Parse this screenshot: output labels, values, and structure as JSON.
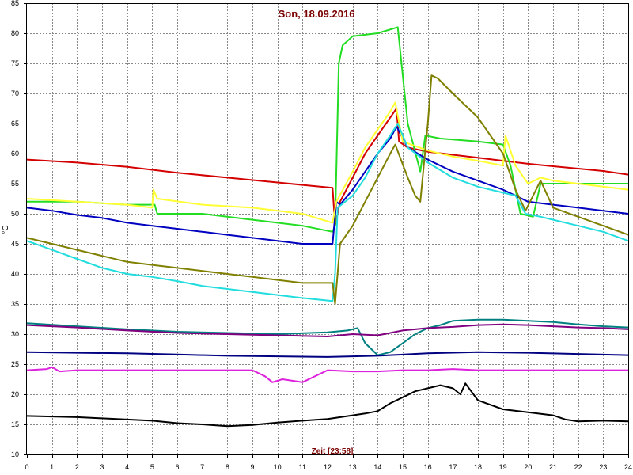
{
  "chart_data": {
    "type": "line",
    "title": "Son, 18.09.2016",
    "xlabel": "Zeit [23:58]",
    "ylabel": "°C",
    "xlim": [
      0,
      24
    ],
    "ylim": [
      10,
      85
    ],
    "x_ticks": [
      "0",
      "1",
      "2",
      "3",
      "4",
      "5",
      "6",
      "7",
      "8",
      "9",
      "10",
      "11",
      "12",
      "13",
      "14",
      "15",
      "16",
      "17",
      "18",
      "19",
      "20",
      "21",
      "22",
      "23",
      "24"
    ],
    "y_ticks": [
      "10",
      "15",
      "20",
      "25",
      "30",
      "35",
      "40",
      "45",
      "50",
      "55",
      "60",
      "65",
      "70",
      "75",
      "80",
      "85"
    ],
    "grid": true,
    "series": [
      {
        "color": "#d40000",
        "points": [
          [
            0,
            59
          ],
          [
            2,
            58.5
          ],
          [
            4,
            57.8
          ],
          [
            6,
            56.8
          ],
          [
            8,
            56
          ],
          [
            10,
            55.2
          ],
          [
            12.2,
            54.3
          ],
          [
            12.3,
            48
          ],
          [
            12.5,
            52
          ],
          [
            13,
            56
          ],
          [
            13.5,
            60
          ],
          [
            14,
            63
          ],
          [
            14.5,
            66
          ],
          [
            14.75,
            67.5
          ],
          [
            14.85,
            62
          ],
          [
            15.2,
            61
          ],
          [
            16,
            60.3
          ],
          [
            17,
            59.8
          ],
          [
            18,
            59.3
          ],
          [
            19,
            58.8
          ],
          [
            20,
            58.3
          ],
          [
            21,
            57.9
          ],
          [
            22,
            57.5
          ],
          [
            23,
            57.1
          ],
          [
            24,
            56.5
          ]
        ]
      },
      {
        "color": "#22dd22",
        "points": [
          [
            0,
            52
          ],
          [
            2,
            52
          ],
          [
            4,
            51.5
          ],
          [
            5.1,
            51.5
          ],
          [
            5.2,
            50
          ],
          [
            7,
            50
          ],
          [
            9,
            49
          ],
          [
            11,
            48
          ],
          [
            12.2,
            47
          ],
          [
            12.3,
            48
          ],
          [
            12.45,
            75
          ],
          [
            12.6,
            78
          ],
          [
            13,
            79.5
          ],
          [
            14,
            80
          ],
          [
            14.8,
            81
          ],
          [
            15.2,
            65
          ],
          [
            15.7,
            57
          ],
          [
            15.9,
            63
          ],
          [
            16.5,
            62.5
          ],
          [
            18,
            62
          ],
          [
            19,
            61.5
          ],
          [
            19.3,
            58
          ],
          [
            19.7,
            50
          ],
          [
            20.2,
            49.5
          ],
          [
            20.5,
            55
          ],
          [
            21,
            55
          ],
          [
            22,
            55
          ],
          [
            23,
            55
          ],
          [
            24,
            55
          ]
        ]
      },
      {
        "color": "#0000c0",
        "points": [
          [
            0,
            51
          ],
          [
            1,
            50.5
          ],
          [
            2,
            49.8
          ],
          [
            3,
            49.3
          ],
          [
            4,
            48.5
          ],
          [
            5,
            48
          ],
          [
            6,
            47.5
          ],
          [
            7,
            47
          ],
          [
            8,
            46.5
          ],
          [
            9,
            46
          ],
          [
            10,
            45.5
          ],
          [
            11,
            45
          ],
          [
            12.2,
            45
          ],
          [
            12.35,
            52
          ],
          [
            12.5,
            51.5
          ],
          [
            13,
            54
          ],
          [
            13.5,
            57
          ],
          [
            14,
            60
          ],
          [
            14.5,
            62.5
          ],
          [
            14.75,
            64.5
          ],
          [
            15.2,
            61
          ],
          [
            16,
            59
          ],
          [
            17,
            57
          ],
          [
            18,
            55.5
          ],
          [
            19,
            54
          ],
          [
            19.5,
            53
          ],
          [
            20,
            52
          ],
          [
            21,
            51.5
          ],
          [
            22,
            51
          ],
          [
            23,
            50.5
          ],
          [
            24,
            50
          ]
        ]
      },
      {
        "color": "#ffff33",
        "points": [
          [
            0,
            52.5
          ],
          [
            2,
            52
          ],
          [
            4,
            51.5
          ],
          [
            5,
            51
          ],
          [
            5.05,
            54
          ],
          [
            5.2,
            52.5
          ],
          [
            7,
            51.5
          ],
          [
            9,
            51
          ],
          [
            11,
            50
          ],
          [
            12.2,
            48.5
          ],
          [
            12.35,
            52
          ],
          [
            13,
            57
          ],
          [
            13.5,
            61
          ],
          [
            14,
            64
          ],
          [
            14.5,
            67
          ],
          [
            14.7,
            68.5
          ],
          [
            15,
            62
          ],
          [
            16,
            60.5
          ],
          [
            17,
            59.5
          ],
          [
            18,
            58.8
          ],
          [
            19,
            58
          ],
          [
            19.1,
            63
          ],
          [
            19.5,
            58
          ],
          [
            20,
            55
          ],
          [
            20.5,
            56
          ],
          [
            21,
            55.5
          ],
          [
            22,
            55
          ],
          [
            23,
            54.5
          ],
          [
            24,
            54
          ]
        ]
      },
      {
        "color": "#22dddd",
        "points": [
          [
            0,
            45.5
          ],
          [
            1,
            44
          ],
          [
            2,
            42.5
          ],
          [
            3,
            41
          ],
          [
            4,
            40
          ],
          [
            5,
            39.5
          ],
          [
            6,
            38.8
          ],
          [
            7,
            38
          ],
          [
            8,
            37.5
          ],
          [
            9,
            37
          ],
          [
            10,
            36.5
          ],
          [
            11,
            36
          ],
          [
            12.2,
            35.5
          ],
          [
            12.3,
            40
          ],
          [
            12.4,
            51
          ],
          [
            13,
            53
          ],
          [
            13.5,
            56
          ],
          [
            14,
            60
          ],
          [
            14.5,
            63
          ],
          [
            14.8,
            65
          ],
          [
            15.2,
            61
          ],
          [
            16,
            58.5
          ],
          [
            17,
            56
          ],
          [
            18,
            54.5
          ],
          [
            19,
            53.5
          ],
          [
            19.5,
            53
          ],
          [
            19.9,
            50
          ],
          [
            20.5,
            49.5
          ],
          [
            21,
            49
          ],
          [
            22,
            48
          ],
          [
            23,
            47
          ],
          [
            24,
            45.5
          ]
        ]
      },
      {
        "color": "#808000",
        "points": [
          [
            0,
            46
          ],
          [
            1,
            45
          ],
          [
            2,
            44
          ],
          [
            3,
            43
          ],
          [
            4,
            42
          ],
          [
            5,
            41.5
          ],
          [
            6,
            41
          ],
          [
            7,
            40.5
          ],
          [
            8,
            40
          ],
          [
            9,
            39.5
          ],
          [
            10,
            39
          ],
          [
            11,
            38.5
          ],
          [
            12.2,
            38.5
          ],
          [
            12.3,
            35
          ],
          [
            12.5,
            45
          ],
          [
            13,
            48
          ],
          [
            13.5,
            52
          ],
          [
            14,
            56
          ],
          [
            14.5,
            60
          ],
          [
            14.7,
            61.5
          ],
          [
            15.2,
            56
          ],
          [
            15.5,
            53
          ],
          [
            15.7,
            52
          ],
          [
            16,
            65
          ],
          [
            16.15,
            73
          ],
          [
            16.4,
            72.5
          ],
          [
            17,
            70
          ],
          [
            18,
            66
          ],
          [
            19,
            60
          ],
          [
            19.5,
            54
          ],
          [
            19.9,
            50.5
          ],
          [
            20.2,
            53
          ],
          [
            20.5,
            55.5
          ],
          [
            21,
            51
          ],
          [
            22,
            49.5
          ],
          [
            23,
            48
          ],
          [
            24,
            46.5
          ]
        ]
      },
      {
        "color": "#008080",
        "points": [
          [
            0,
            31.8
          ],
          [
            2,
            31.3
          ],
          [
            4,
            30.8
          ],
          [
            6,
            30.4
          ],
          [
            8,
            30.2
          ],
          [
            10,
            30
          ],
          [
            12,
            30.3
          ],
          [
            12.8,
            30.6
          ],
          [
            13.2,
            31
          ],
          [
            13.5,
            28.5
          ],
          [
            14,
            26.5
          ],
          [
            14.5,
            27
          ],
          [
            15,
            28.5
          ],
          [
            15.5,
            30
          ],
          [
            16,
            31
          ],
          [
            16.5,
            31.5
          ],
          [
            17,
            32.2
          ],
          [
            18,
            32.4
          ],
          [
            19,
            32.4
          ],
          [
            20,
            32.2
          ],
          [
            21,
            32
          ],
          [
            22,
            31.6
          ],
          [
            23,
            31.3
          ],
          [
            24,
            31.1
          ]
        ]
      },
      {
        "color": "#800080",
        "points": [
          [
            0,
            31.5
          ],
          [
            2,
            31.1
          ],
          [
            4,
            30.6
          ],
          [
            6,
            30.2
          ],
          [
            8,
            30
          ],
          [
            10,
            29.8
          ],
          [
            12,
            29.6
          ],
          [
            13,
            30
          ],
          [
            14,
            29.8
          ],
          [
            14.5,
            30.2
          ],
          [
            15,
            30.6
          ],
          [
            16,
            31
          ],
          [
            17,
            31.2
          ],
          [
            18,
            31.5
          ],
          [
            19,
            31.6
          ],
          [
            20,
            31.5
          ],
          [
            21,
            31.3
          ],
          [
            22,
            31.1
          ],
          [
            23,
            31
          ],
          [
            24,
            30.8
          ]
        ]
      },
      {
        "color": "#000080",
        "points": [
          [
            0,
            27
          ],
          [
            2,
            26.9
          ],
          [
            4,
            26.8
          ],
          [
            6,
            26.6
          ],
          [
            8,
            26.4
          ],
          [
            10,
            26.3
          ],
          [
            12,
            26.2
          ],
          [
            14,
            26.4
          ],
          [
            16,
            26.8
          ],
          [
            18,
            27
          ],
          [
            20,
            26.9
          ],
          [
            22,
            26.7
          ],
          [
            24,
            26.5
          ]
        ]
      },
      {
        "color": "#dd22dd",
        "points": [
          [
            0,
            24
          ],
          [
            0.8,
            24.2
          ],
          [
            1,
            24.5
          ],
          [
            1.3,
            23.8
          ],
          [
            2,
            24
          ],
          [
            3,
            24
          ],
          [
            4,
            24
          ],
          [
            5,
            24
          ],
          [
            6,
            24
          ],
          [
            7,
            24
          ],
          [
            8,
            24
          ],
          [
            9,
            24
          ],
          [
            9.5,
            23
          ],
          [
            9.8,
            22
          ],
          [
            10.2,
            22.5
          ],
          [
            11,
            22
          ],
          [
            12,
            24
          ],
          [
            13,
            23.8
          ],
          [
            14,
            23.8
          ],
          [
            15,
            24
          ],
          [
            16,
            24
          ],
          [
            17,
            24.2
          ],
          [
            18,
            24
          ],
          [
            19,
            24
          ],
          [
            20,
            24
          ],
          [
            21,
            24
          ],
          [
            22,
            24
          ],
          [
            23,
            24
          ],
          [
            24,
            24
          ]
        ]
      },
      {
        "color": "#000000",
        "points": [
          [
            0,
            16.4
          ],
          [
            1,
            16.3
          ],
          [
            2,
            16.2
          ],
          [
            3,
            16
          ],
          [
            4,
            15.8
          ],
          [
            5,
            15.6
          ],
          [
            6,
            15.2
          ],
          [
            7,
            15
          ],
          [
            8,
            14.7
          ],
          [
            9,
            14.9
          ],
          [
            10,
            15.3
          ],
          [
            11,
            15.6
          ],
          [
            12,
            15.9
          ],
          [
            13,
            16.5
          ],
          [
            13.5,
            16.8
          ],
          [
            14,
            17.2
          ],
          [
            14.5,
            18.5
          ],
          [
            15,
            19.5
          ],
          [
            15.5,
            20.5
          ],
          [
            16,
            21
          ],
          [
            16.5,
            21.5
          ],
          [
            17,
            21
          ],
          [
            17.3,
            20
          ],
          [
            17.5,
            21.8
          ],
          [
            18,
            19
          ],
          [
            19,
            17.5
          ],
          [
            20,
            17
          ],
          [
            21,
            16.5
          ],
          [
            21.5,
            15.8
          ],
          [
            22,
            15.5
          ],
          [
            23,
            15.6
          ],
          [
            24,
            15.5
          ]
        ]
      }
    ]
  }
}
